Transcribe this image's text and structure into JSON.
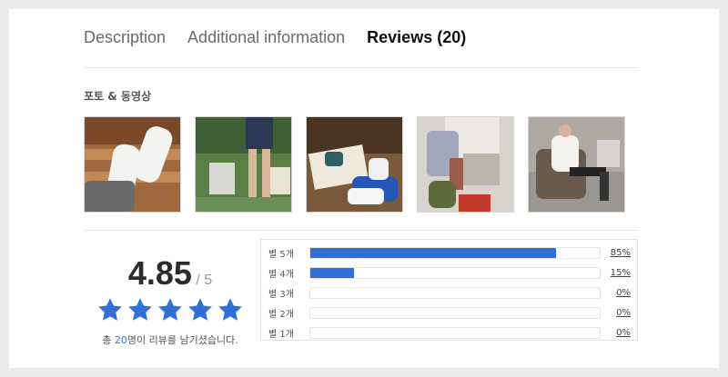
{
  "tabs": [
    {
      "label": "Description"
    },
    {
      "label": "Additional information"
    },
    {
      "label": "Reviews (20)"
    }
  ],
  "photo_section": {
    "title": "포토 & 동영상",
    "photos": [
      {
        "name": "review-photo-1"
      },
      {
        "name": "review-photo-2"
      },
      {
        "name": "review-photo-3"
      },
      {
        "name": "review-photo-4"
      },
      {
        "name": "review-photo-5"
      },
      {
        "name": "review-photo-6"
      }
    ]
  },
  "rating": {
    "score": "4.85",
    "out_of": "/ 5",
    "stars": 5,
    "star_color": "#2f6fd6",
    "total_prefix": "총 ",
    "total_count": "20",
    "total_suffix": "명이 리뷰를 남기셨습니다."
  },
  "distribution": [
    {
      "label": "별 5개",
      "percent": 85,
      "percent_label": "85%"
    },
    {
      "label": "별 4개",
      "percent": 15,
      "percent_label": "15%"
    },
    {
      "label": "별 3개",
      "percent": 0,
      "percent_label": "0%"
    },
    {
      "label": "별 2개",
      "percent": 0,
      "percent_label": "0%"
    },
    {
      "label": "별 1개",
      "percent": 0,
      "percent_label": "0%"
    }
  ],
  "colors": {
    "accent": "#2f6fd6",
    "active_tab": "#111111",
    "inactive_tab": "#6b6b6b"
  }
}
